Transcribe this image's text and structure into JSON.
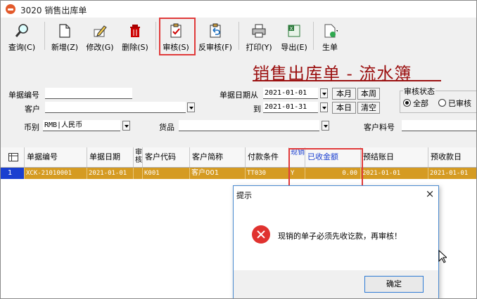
{
  "window": {
    "title": "3020 销售出库单"
  },
  "toolbar": {
    "items": [
      {
        "label": "查询(C)",
        "icon": "magnifier-icon"
      },
      {
        "label": "新增(Z)",
        "icon": "new-document-icon"
      },
      {
        "label": "修改(G)",
        "icon": "edit-pen-icon"
      },
      {
        "label": "删除(S)",
        "icon": "trash-icon"
      },
      {
        "label": "审核(S)",
        "icon": "clipboard-check-icon"
      },
      {
        "label": "反审核(F)",
        "icon": "clipboard-undo-icon"
      },
      {
        "label": "打印(Y)",
        "icon": "printer-icon"
      },
      {
        "label": "导出(E)",
        "icon": "excel-export-icon"
      },
      {
        "label": "生单",
        "icon": "generate-document-icon"
      }
    ]
  },
  "heading": "销售出库单 - 流水簿",
  "filters": {
    "doc_no_label": "单据编号",
    "doc_no_value": "",
    "customer_label": "客户",
    "customer_value": "",
    "currency_label": "币别",
    "currency_value": "RMB|人民币",
    "goods_label": "货品",
    "goods_value": "",
    "date_from_label": "单据日期从",
    "date_from_value": "2021-01-01",
    "date_to_label": "到",
    "date_to_value": "2021-01-31",
    "this_month": "本月",
    "this_week": "本周",
    "today": "本日",
    "clear": "清空",
    "customer_part_label": "客户料号",
    "customer_part_value": "",
    "audit_status_label": "审核状态",
    "audit_all": "全部",
    "audited": "已审核"
  },
  "grid": {
    "columns": [
      "单据编号",
      "单据日期",
      "审核",
      "客户代码",
      "客户简称",
      "付款条件",
      "现销",
      "已收金额",
      "预结账日",
      "预收款日"
    ],
    "rows": [
      [
        "XCK-21010001",
        "2021-01-01",
        "",
        "K001",
        "客户001",
        "TT030",
        "Y",
        "0.00",
        "2021-01-01",
        "2021-01-01"
      ]
    ],
    "row_numbers": [
      "1"
    ]
  },
  "dialog": {
    "title": "提示",
    "message": "现销的单子必须先收讫款，再审核！",
    "ok": "确定",
    "close": "×"
  },
  "colors": {
    "title_red": "#9b1010",
    "row_highlight": "#d59b22",
    "highlight_box": "#e03a3a",
    "selected_blue": "#1a3fd0"
  }
}
